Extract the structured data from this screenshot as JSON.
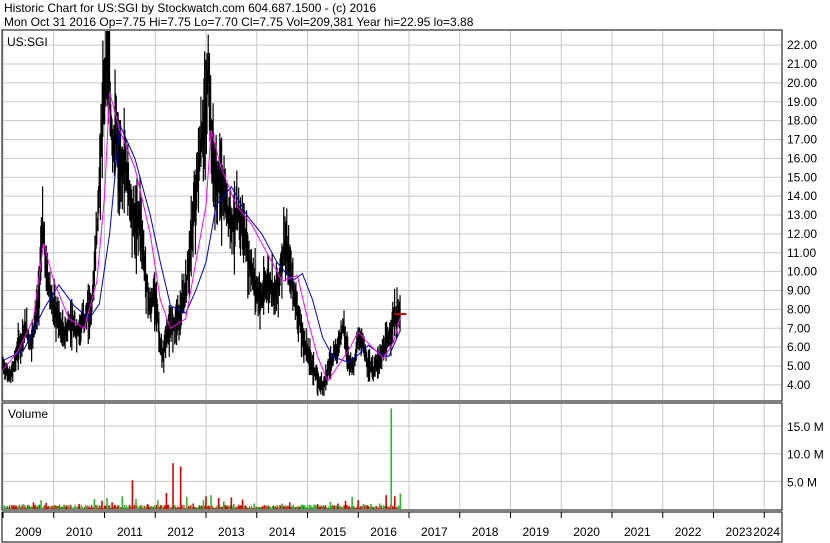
{
  "header": {
    "line1": "Historic Chart for US:SGI by Stockwatch.com 604.687.1500 - (c) 2016",
    "line2": "Mon Oct 31 2016   Op=7.75  Hi=7.75  Lo=7.70  Cl=7.75  Vol=209,381  Year hi=22.95  lo=3.88"
  },
  "colors": {
    "price": "#000000",
    "ma_short": "#ff00ff",
    "ma_long": "#0000cc",
    "volume_up": "#2db82d",
    "volume_down": "#dd0000",
    "grid": "#c8c8c8",
    "last_marker": "#cc0000"
  },
  "chart_data": [
    {
      "type": "line",
      "panel": "price",
      "label": "US:SGI",
      "x_unit": "year",
      "xlim": [
        2009.0,
        2024.35
      ],
      "ylim": [
        3.2,
        22.75
      ],
      "y_ticks": [
        "4.00",
        "5.00",
        "6.00",
        "7.00",
        "8.00",
        "9.00",
        "10.00",
        "11.00",
        "12.00",
        "13.00",
        "14.00",
        "15.00",
        "16.00",
        "17.00",
        "18.00",
        "19.00",
        "20.00",
        "21.00",
        "22.00"
      ],
      "x_ticks": [
        "2009",
        "2010",
        "2011",
        "2012",
        "2013",
        "2014",
        "2015",
        "2016",
        "2017",
        "2018",
        "2019",
        "2020",
        "2021",
        "2022",
        "2023",
        "2024"
      ],
      "series": [
        {
          "role": "price",
          "x": [
            2009.0,
            2009.15,
            2009.3,
            2009.45,
            2009.55,
            2009.7,
            2009.78,
            2009.85,
            2009.93,
            2010.0,
            2010.1,
            2010.2,
            2010.3,
            2010.45,
            2010.6,
            2010.75,
            2010.85,
            2010.92,
            2011.0,
            2011.05,
            2011.12,
            2011.18,
            2011.22,
            2011.3,
            2011.4,
            2011.5,
            2011.6,
            2011.7,
            2011.8,
            2011.9,
            2012.0,
            2012.1,
            2012.15,
            2012.2,
            2012.3,
            2012.4,
            2012.5,
            2012.6,
            2012.7,
            2012.8,
            2012.85,
            2012.92,
            2013.0,
            2013.05,
            2013.1,
            2013.15,
            2013.2,
            2013.28,
            2013.35,
            2013.45,
            2013.55,
            2013.65,
            2013.75,
            2013.85,
            2014.0,
            2014.1,
            2014.2,
            2014.3,
            2014.4,
            2014.55,
            2014.7,
            2014.8,
            2014.9,
            2015.0,
            2015.1,
            2015.2,
            2015.3,
            2015.4,
            2015.5,
            2015.6,
            2015.7,
            2015.8,
            2015.9,
            2016.0,
            2016.1,
            2016.2,
            2016.3,
            2016.4,
            2016.5,
            2016.6,
            2016.7,
            2016.83
          ],
          "y": [
            5.0,
            4.4,
            6.0,
            7.0,
            6.2,
            8.5,
            12.5,
            10.0,
            9.0,
            8.0,
            7.4,
            6.5,
            7.3,
            6.8,
            7.5,
            8.2,
            12.0,
            16.0,
            20.0,
            22.95,
            18.0,
            16.5,
            17.5,
            15.0,
            16.0,
            14.0,
            12.5,
            13.0,
            10.0,
            8.0,
            9.0,
            6.0,
            5.3,
            6.5,
            7.0,
            7.5,
            7.8,
            9.0,
            11.5,
            14.0,
            15.5,
            17.0,
            18.5,
            21.0,
            17.0,
            15.5,
            14.5,
            15.0,
            14.0,
            13.0,
            12.5,
            13.0,
            12.0,
            10.5,
            9.0,
            8.5,
            9.5,
            9.2,
            9.0,
            11.5,
            9.5,
            8.0,
            6.5,
            5.8,
            5.0,
            4.2,
            4.0,
            4.8,
            5.5,
            6.0,
            7.2,
            5.5,
            4.9,
            6.5,
            6.2,
            5.0,
            4.8,
            5.3,
            5.8,
            6.5,
            7.5,
            7.75
          ]
        },
        {
          "role": "moving_average_short",
          "x": [
            2009.0,
            2009.3,
            2009.6,
            2009.8,
            2010.0,
            2010.3,
            2010.6,
            2010.85,
            2011.0,
            2011.1,
            2011.3,
            2011.6,
            2011.9,
            2012.1,
            2012.3,
            2012.6,
            2012.8,
            2013.0,
            2013.1,
            2013.3,
            2013.6,
            2013.9,
            2014.2,
            2014.5,
            2014.8,
            2015.0,
            2015.2,
            2015.4,
            2015.6,
            2015.8,
            2016.0,
            2016.2,
            2016.5,
            2016.7,
            2016.83
          ],
          "y": [
            4.8,
            5.8,
            7.5,
            11.5,
            9.5,
            7.5,
            7.0,
            9.5,
            14.0,
            19.5,
            17.5,
            15.5,
            12.0,
            8.5,
            7.0,
            7.5,
            10.5,
            13.5,
            17.5,
            15.5,
            13.5,
            12.5,
            11.0,
            9.5,
            9.8,
            7.5,
            5.5,
            4.2,
            5.0,
            5.8,
            6.8,
            6.2,
            5.4,
            6.3,
            7.6
          ]
        },
        {
          "role": "moving_average_long",
          "x": [
            2009.0,
            2009.4,
            2009.8,
            2010.1,
            2010.4,
            2010.7,
            2010.9,
            2011.1,
            2011.3,
            2011.6,
            2011.9,
            2012.1,
            2012.3,
            2012.6,
            2012.8,
            2013.0,
            2013.2,
            2013.5,
            2013.8,
            2014.1,
            2014.4,
            2014.7,
            2014.9,
            2015.1,
            2015.3,
            2015.5,
            2015.8,
            2016.0,
            2016.2,
            2016.4,
            2016.6,
            2016.83
          ],
          "y": [
            5.3,
            5.8,
            8.0,
            9.3,
            8.2,
            7.5,
            8.3,
            12.0,
            17.8,
            16.0,
            13.0,
            10.5,
            8.2,
            7.8,
            9.0,
            10.5,
            13.5,
            14.5,
            13.0,
            12.0,
            10.5,
            9.5,
            9.9,
            8.5,
            6.5,
            5.5,
            5.2,
            5.6,
            6.1,
            5.7,
            5.5,
            6.9
          ]
        }
      ],
      "last_close": 7.75
    },
    {
      "type": "bar",
      "panel": "volume",
      "label": "Volume",
      "ylim": [
        0,
        19000000
      ],
      "y_ticks": [
        "5.0 M",
        "10.0 M",
        "15.0 M"
      ],
      "bars": [
        {
          "x": 2009.2,
          "v": 600000,
          "dir": "down"
        },
        {
          "x": 2009.4,
          "v": 900000,
          "dir": "up"
        },
        {
          "x": 2009.6,
          "v": 1200000,
          "dir": "down"
        },
        {
          "x": 2009.75,
          "v": 1600000,
          "dir": "up"
        },
        {
          "x": 2009.85,
          "v": 1100000,
          "dir": "down"
        },
        {
          "x": 2010.2,
          "v": 700000,
          "dir": "up"
        },
        {
          "x": 2010.5,
          "v": 900000,
          "dir": "down"
        },
        {
          "x": 2010.8,
          "v": 1800000,
          "dir": "up"
        },
        {
          "x": 2010.95,
          "v": 1500000,
          "dir": "down"
        },
        {
          "x": 2011.05,
          "v": 2000000,
          "dir": "up"
        },
        {
          "x": 2011.15,
          "v": 1200000,
          "dir": "down"
        },
        {
          "x": 2011.35,
          "v": 2300000,
          "dir": "up"
        },
        {
          "x": 2011.55,
          "v": 5200000,
          "dir": "down"
        },
        {
          "x": 2011.62,
          "v": 1800000,
          "dir": "up"
        },
        {
          "x": 2011.85,
          "v": 900000,
          "dir": "down"
        },
        {
          "x": 2012.05,
          "v": 1600000,
          "dir": "up"
        },
        {
          "x": 2012.22,
          "v": 2900000,
          "dir": "down"
        },
        {
          "x": 2012.35,
          "v": 8300000,
          "dir": "down"
        },
        {
          "x": 2012.5,
          "v": 7700000,
          "dir": "down"
        },
        {
          "x": 2012.62,
          "v": 2200000,
          "dir": "up"
        },
        {
          "x": 2012.75,
          "v": 1000000,
          "dir": "down"
        },
        {
          "x": 2012.95,
          "v": 1600000,
          "dir": "up"
        },
        {
          "x": 2013.0,
          "v": 2300000,
          "dir": "down"
        },
        {
          "x": 2013.1,
          "v": 2500000,
          "dir": "up"
        },
        {
          "x": 2013.25,
          "v": 2000000,
          "dir": "down"
        },
        {
          "x": 2013.35,
          "v": 1400000,
          "dir": "up"
        },
        {
          "x": 2013.5,
          "v": 2100000,
          "dir": "down"
        },
        {
          "x": 2013.55,
          "v": 900000,
          "dir": "up"
        },
        {
          "x": 2013.72,
          "v": 1700000,
          "dir": "down"
        },
        {
          "x": 2013.95,
          "v": 1000000,
          "dir": "up"
        },
        {
          "x": 2014.15,
          "v": 700000,
          "dir": "down"
        },
        {
          "x": 2014.5,
          "v": 1000000,
          "dir": "up"
        },
        {
          "x": 2014.65,
          "v": 1200000,
          "dir": "down"
        },
        {
          "x": 2014.9,
          "v": 800000,
          "dir": "up"
        },
        {
          "x": 2015.2,
          "v": 900000,
          "dir": "down"
        },
        {
          "x": 2015.45,
          "v": 1300000,
          "dir": "up"
        },
        {
          "x": 2015.6,
          "v": 1000000,
          "dir": "down"
        },
        {
          "x": 2015.75,
          "v": 1500000,
          "dir": "down"
        },
        {
          "x": 2015.88,
          "v": 2200000,
          "dir": "up"
        },
        {
          "x": 2016.0,
          "v": 1600000,
          "dir": "down"
        },
        {
          "x": 2016.1,
          "v": 900000,
          "dir": "up"
        },
        {
          "x": 2016.18,
          "v": 700000,
          "dir": "down"
        },
        {
          "x": 2016.25,
          "v": 900000,
          "dir": "up"
        },
        {
          "x": 2016.42,
          "v": 1000000,
          "dir": "up"
        },
        {
          "x": 2016.55,
          "v": 2500000,
          "dir": "down"
        },
        {
          "x": 2016.65,
          "v": 18200000,
          "dir": "up"
        },
        {
          "x": 2016.72,
          "v": 2300000,
          "dir": "down"
        },
        {
          "x": 2016.83,
          "v": 2800000,
          "dir": "up"
        }
      ]
    }
  ]
}
